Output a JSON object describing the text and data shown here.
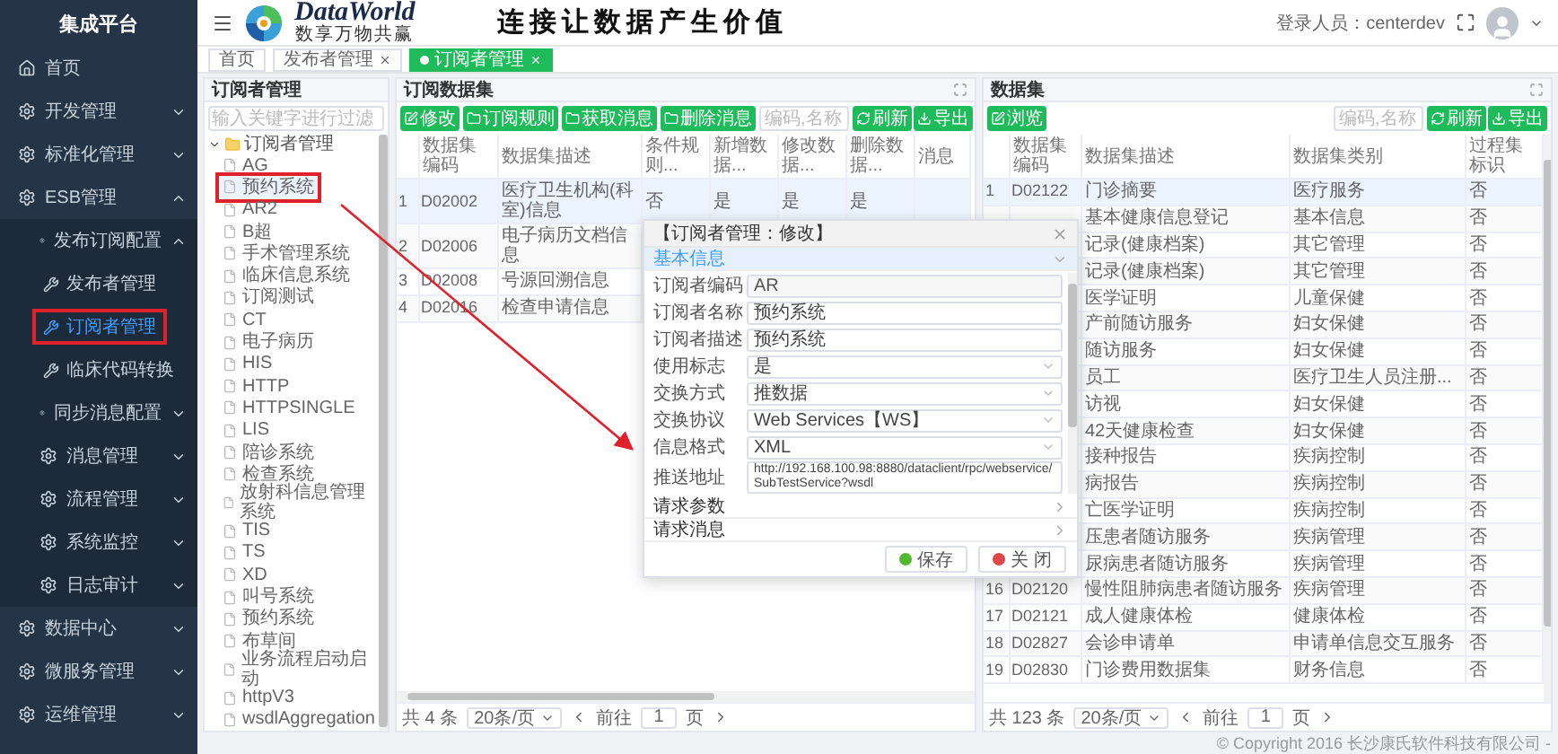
{
  "sidebar": {
    "title": "集成平台",
    "items": [
      {
        "label": "首页",
        "kind": "link"
      },
      {
        "label": "开发管理",
        "kind": "menu",
        "expanded": false
      },
      {
        "label": "标准化管理",
        "kind": "menu",
        "expanded": false
      },
      {
        "label": "ESB管理",
        "kind": "menu",
        "expanded": true,
        "children": [
          {
            "label": "发布订阅配置",
            "kind": "menu",
            "expanded": true,
            "children": [
              {
                "label": "发布者管理",
                "kind": "page",
                "selected": false,
                "marked": false
              },
              {
                "label": "订阅者管理",
                "kind": "page",
                "selected": true,
                "marked": true
              },
              {
                "label": "临床代码转换",
                "kind": "page",
                "selected": false,
                "marked": false
              }
            ]
          },
          {
            "label": "同步消息配置",
            "kind": "menu",
            "expanded": false
          },
          {
            "label": "消息管理",
            "kind": "menu",
            "expanded": false
          },
          {
            "label": "流程管理",
            "kind": "menu",
            "expanded": false
          },
          {
            "label": "系统监控",
            "kind": "menu",
            "expanded": false
          },
          {
            "label": "日志审计",
            "kind": "menu",
            "expanded": false
          }
        ]
      },
      {
        "label": "数据中心",
        "kind": "menu",
        "expanded": false
      },
      {
        "label": "微服务管理",
        "kind": "menu",
        "expanded": false
      },
      {
        "label": "运维管理",
        "kind": "menu",
        "expanded": false
      }
    ]
  },
  "header": {
    "brand": "DataWorld",
    "tagline": "数享万物共赢",
    "slogan": "连接让数据产生价值",
    "user": "登录人员：centerdev"
  },
  "tabs": [
    {
      "label": "首页",
      "selected": false,
      "closable": false
    },
    {
      "label": "发布者管理",
      "selected": false,
      "closable": true
    },
    {
      "label": "订阅者管理",
      "selected": true,
      "closable": true
    }
  ],
  "tree": {
    "title": "订阅者管理",
    "filter_placeholder": "输入关键字进行过滤",
    "root": {
      "label": "订阅者管理",
      "expanded": true,
      "children": [
        {
          "label": "AG",
          "selected": false,
          "marked": false
        },
        {
          "label": "预约系统",
          "selected": true,
          "marked": true
        },
        {
          "label": "AR2",
          "selected": false,
          "marked": false
        },
        {
          "label": "B超",
          "selected": false,
          "marked": false
        },
        {
          "label": "手术管理系统",
          "selected": false,
          "marked": false
        },
        {
          "label": "临床信息系统",
          "selected": false,
          "marked": false
        },
        {
          "label": "订阅测试",
          "selected": false,
          "marked": false
        },
        {
          "label": "CT",
          "selected": false,
          "marked": false
        },
        {
          "label": "电子病历",
          "selected": false,
          "marked": false
        },
        {
          "label": "HIS",
          "selected": false,
          "marked": false
        },
        {
          "label": "HTTP",
          "selected": false,
          "marked": false
        },
        {
          "label": "HTTPSINGLE",
          "selected": false,
          "marked": false
        },
        {
          "label": "LIS",
          "selected": false,
          "marked": false
        },
        {
          "label": "陪诊系统",
          "selected": false,
          "marked": false
        },
        {
          "label": "检查系统",
          "selected": false,
          "marked": false
        },
        {
          "label": "放射科信息管理系统",
          "selected": false,
          "marked": false
        },
        {
          "label": "TIS",
          "selected": false,
          "marked": false
        },
        {
          "label": "TS",
          "selected": false,
          "marked": false
        },
        {
          "label": "XD",
          "selected": false,
          "marked": false
        },
        {
          "label": "叫号系统",
          "selected": false,
          "marked": false
        },
        {
          "label": "预约系统",
          "selected": false,
          "marked": false
        },
        {
          "label": "布草间",
          "selected": false,
          "marked": false
        },
        {
          "label": "业务流程启动启动",
          "selected": false,
          "marked": false
        },
        {
          "label": "httpV3",
          "selected": false,
          "marked": false
        },
        {
          "label": "wsdlAggregation",
          "selected": false,
          "marked": false
        }
      ]
    }
  },
  "subscription_datasets": {
    "title": "订阅数据集",
    "buttons": [
      {
        "label": "修改",
        "kind": "edit"
      },
      {
        "label": "订阅规则",
        "kind": "folder"
      },
      {
        "label": "获取消息",
        "kind": "folder"
      },
      {
        "label": "删除消息",
        "kind": "folder"
      }
    ],
    "search_placeholder": "编码,名称",
    "tools": [
      {
        "label": "刷新",
        "kind": "refresh"
      },
      {
        "label": "导出",
        "kind": "export"
      }
    ],
    "columns": [
      "数据集编码",
      "数据集描述",
      "条件规则...",
      "新增数据...",
      "修改数据...",
      "删除数据...",
      "消息"
    ],
    "rows": [
      {
        "number": "1",
        "cells": [
          "D02002",
          "医疗卫生机构(科室)信息",
          "否",
          "是",
          "是",
          "是"
        ],
        "selected": true
      },
      {
        "number": "2",
        "cells": [
          "D02006",
          "电子病历文档信息"
        ],
        "selected": false
      },
      {
        "number": "3",
        "cells": [
          "D02008",
          "号源回溯信息"
        ],
        "selected": false
      },
      {
        "number": "4",
        "cells": [
          "D02016",
          "检查申请信息"
        ],
        "selected": false
      }
    ],
    "pager": {
      "total": "共 4 条",
      "page_size": "20条/页",
      "goto": "前往",
      "page": "1",
      "unit": "页"
    }
  },
  "datasets": {
    "title": "数据集",
    "buttons": [
      {
        "label": "浏览",
        "kind": "edit"
      }
    ],
    "search_placeholder": "编码,名称",
    "tools": [
      {
        "label": "刷新",
        "kind": "refresh"
      },
      {
        "label": "导出",
        "kind": "export"
      }
    ],
    "columns": [
      "数据集编码",
      "数据集描述",
      "数据集类别",
      "过程集标识"
    ],
    "rows": [
      {
        "number": "1",
        "code": "D02122",
        "description": "门诊摘要",
        "category": "医疗服务",
        "flag": "否",
        "selected": true
      },
      {
        "description": "基本健康信息登记",
        "category": "基本信息",
        "flag": "否",
        "selected": false
      },
      {
        "description": "记录(健康档案)",
        "category": "其它管理",
        "flag": "否",
        "selected": false
      },
      {
        "description": "记录(健康档案)",
        "category": "其它管理",
        "flag": "否",
        "selected": false
      },
      {
        "description": "医学证明",
        "category": "儿童保健",
        "flag": "否",
        "selected": false
      },
      {
        "description": "产前随访服务",
        "category": "妇女保健",
        "flag": "否",
        "selected": false
      },
      {
        "description": "随访服务",
        "category": "妇女保健",
        "flag": "否",
        "selected": false
      },
      {
        "description": "员工",
        "category": "医疗卫生人员注册...",
        "flag": "否",
        "selected": false
      },
      {
        "description": "访视",
        "category": "妇女保健",
        "flag": "否",
        "selected": false
      },
      {
        "description": "42天健康检查",
        "category": "妇女保健",
        "flag": "否",
        "selected": false
      },
      {
        "description": "接种报告",
        "category": "疾病控制",
        "flag": "否",
        "selected": false
      },
      {
        "description": "病报告",
        "category": "疾病控制",
        "flag": "否",
        "selected": false
      },
      {
        "description": "亡医学证明",
        "category": "疾病控制",
        "flag": "否",
        "selected": false
      },
      {
        "description": "压患者随访服务",
        "category": "疾病管理",
        "flag": "否",
        "selected": false
      },
      {
        "description": "尿病患者随访服务",
        "category": "疾病管理",
        "flag": "否",
        "selected": false
      },
      {
        "number": "16",
        "code": "D02120",
        "description": "慢性阻肺病患者随访服务",
        "category": "疾病管理",
        "flag": "否",
        "selected": false
      },
      {
        "number": "17",
        "code": "D02121",
        "description": "成人健康体检",
        "category": "健康体检",
        "flag": "否",
        "selected": false
      },
      {
        "number": "18",
        "code": "D02827",
        "description": "会诊申请单",
        "category": "申请单信息交互服务",
        "flag": "否",
        "selected": false
      },
      {
        "number": "19",
        "code": "D02830",
        "description": "门诊费用数据集",
        "category": "财务信息",
        "flag": "否",
        "selected": false
      }
    ],
    "pager": {
      "total": "共 123 条",
      "page_size": "20条/页",
      "goto": "前往",
      "page": "1",
      "unit": "页"
    }
  },
  "dialog": {
    "title": "【订阅者管理：修改】",
    "section": "基本信息",
    "section_expanded": true,
    "fields": [
      {
        "label": "订阅者编码",
        "value": "AR",
        "kind": "readonly"
      },
      {
        "label": "订阅者名称",
        "value": "预约系统",
        "kind": "text"
      },
      {
        "label": "订阅者描述",
        "value": "预约系统",
        "kind": "text"
      },
      {
        "label": "使用标志",
        "value": "是",
        "kind": "select"
      },
      {
        "label": "交换方式",
        "value": "推数据",
        "kind": "select"
      },
      {
        "label": "交换协议",
        "value": "Web Services【WS】",
        "kind": "select"
      },
      {
        "label": "信息格式",
        "value": "XML",
        "kind": "select"
      },
      {
        "label": "推送地址",
        "value": "http://192.168.100.98:8880/dataclient/rpc/webservice/SubTestService?wsdl",
        "kind": "url"
      }
    ],
    "panels": [
      {
        "label": "请求参数",
        "expanded": false
      },
      {
        "label": "请求消息",
        "expanded": false
      }
    ],
    "buttons": [
      {
        "label": "保存",
        "kind": "save"
      },
      {
        "label": "关 闭",
        "kind": "close"
      }
    ]
  },
  "copyright": "© Copyright 2016 长沙康氏软件科技有限公司 -"
}
